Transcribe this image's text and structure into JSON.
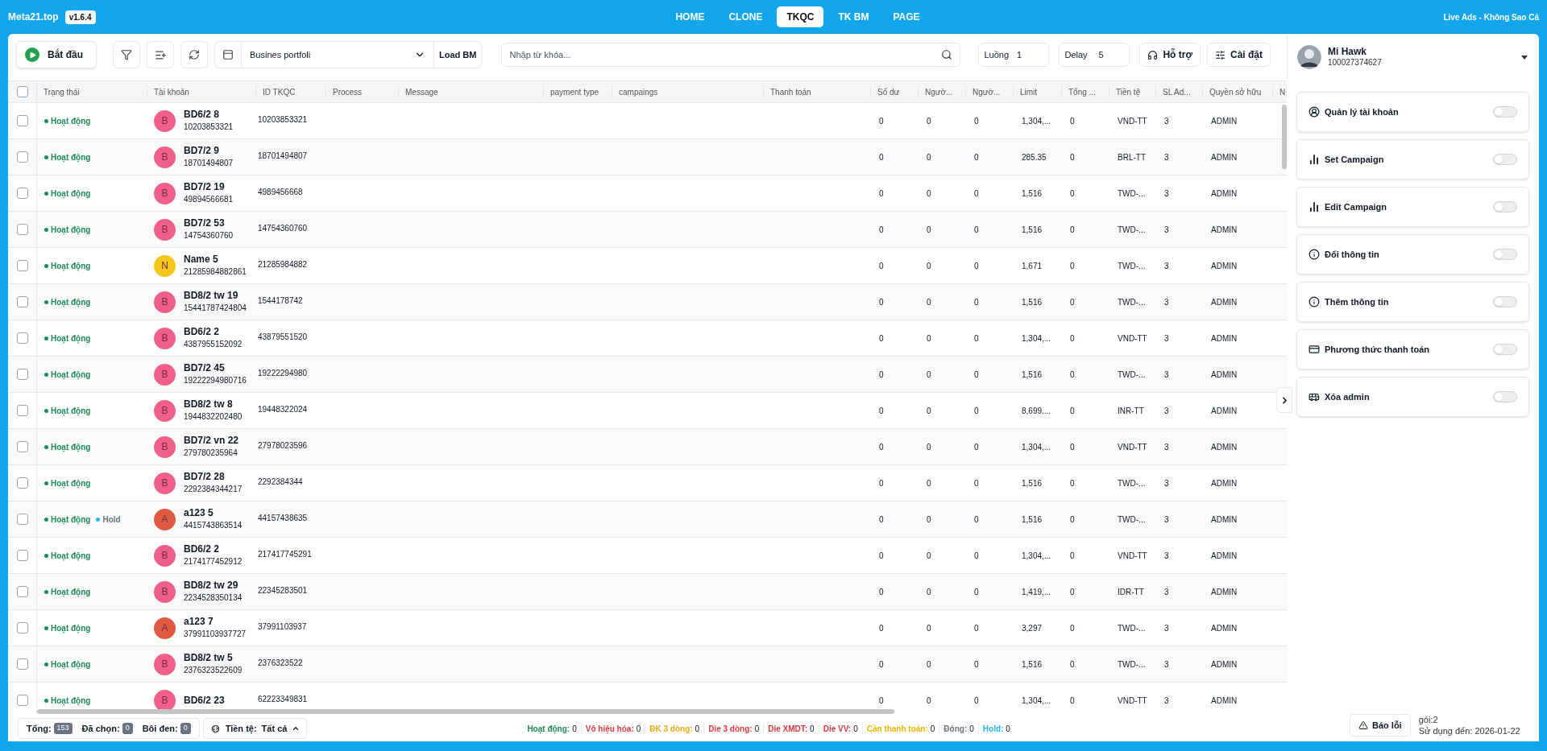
{
  "header": {
    "brand": "Meta21.top",
    "version": "v1.6.4",
    "tabs": [
      {
        "label": "HOME",
        "selected": false
      },
      {
        "label": "CLONE",
        "selected": false
      },
      {
        "label": "TKQC",
        "selected": true
      },
      {
        "label": "TK BM",
        "selected": false
      },
      {
        "label": "PAGE",
        "selected": false
      }
    ],
    "tagline": "Live Ads - Không Sao Cả"
  },
  "toolbar": {
    "start_label": "Bắt đầu",
    "portfolio_select": {
      "value": "Busines portfoli"
    },
    "load_bm_label": "Load BM",
    "search": {
      "placeholder": "Nhập từ khóa..."
    },
    "threads": {
      "label": "Luồng",
      "value": "1"
    },
    "delay": {
      "label": "Delay",
      "value": "5"
    },
    "support_label": "Hỗ trợ",
    "settings_label": "Cài đặt"
  },
  "user": {
    "name": "Mi Hawk",
    "id": "100027374627"
  },
  "table": {
    "select_all": {
      "checked": false
    },
    "columns": [
      "Trạng thái",
      "Tài khoản",
      "ID TKQC",
      "Process",
      "Message",
      "payment type",
      "campaings",
      "Thanh toán",
      "Số dư",
      "Ngườ...",
      "Ngườ...",
      "Limit",
      "Tổng ...",
      "Tiền tệ",
      "SL Ad...",
      "Quyền sở hữu",
      "N"
    ],
    "rows": [
      {
        "checked": false,
        "statuses": [
          {
            "text": "Hoạt động",
            "color": "#1e8a5a"
          }
        ],
        "avatar": {
          "letter": "B",
          "color": "#ee5f8a"
        },
        "name": "BD6/2 8",
        "sub_id": "10203853321",
        "ad_id": "10203853321",
        "values": [
          "0",
          "0",
          "0",
          "1,304,...",
          "0",
          "VND-TT",
          "3",
          "ADMIN"
        ]
      },
      {
        "checked": false,
        "statuses": [
          {
            "text": "Hoạt động",
            "color": "#1e8a5a"
          }
        ],
        "avatar": {
          "letter": "B",
          "color": "#ee5f8a"
        },
        "name": "BD7/2 9",
        "sub_id": "18701494807",
        "ad_id": "18701494807",
        "values": [
          "0",
          "0",
          "0",
          "285.35",
          "0",
          "BRL-TT",
          "3",
          "ADMIN"
        ]
      },
      {
        "checked": false,
        "statuses": [
          {
            "text": "Hoạt động",
            "color": "#1e8a5a"
          }
        ],
        "avatar": {
          "letter": "B",
          "color": "#ee5f8a"
        },
        "name": "BD7/2 19",
        "sub_id": "49894566681",
        "ad_id": "4989456668",
        "values": [
          "0",
          "0",
          "0",
          "1,516",
          "0",
          "TWD-...",
          "3",
          "ADMIN"
        ]
      },
      {
        "checked": false,
        "statuses": [
          {
            "text": "Hoạt động",
            "color": "#1e8a5a"
          }
        ],
        "avatar": {
          "letter": "B",
          "color": "#ee5f8a"
        },
        "name": "BD7/2 53",
        "sub_id": "14754360760",
        "ad_id": "14754360760",
        "values": [
          "0",
          "0",
          "0",
          "1,516",
          "0",
          "TWD-...",
          "3",
          "ADMIN"
        ]
      },
      {
        "checked": false,
        "statuses": [
          {
            "text": "Hoạt động",
            "color": "#1e8a5a"
          }
        ],
        "avatar": {
          "letter": "N",
          "color": "#f5c518"
        },
        "name": "Name 5",
        "sub_id": "21285984882861",
        "ad_id": "21285984882",
        "values": [
          "0",
          "0",
          "0",
          "1,671",
          "0",
          "TWD-...",
          "3",
          "ADMIN"
        ]
      },
      {
        "checked": false,
        "statuses": [
          {
            "text": "Hoạt động",
            "color": "#1e8a5a"
          }
        ],
        "avatar": {
          "letter": "B",
          "color": "#ee5f8a"
        },
        "name": "BD8/2 tw 19",
        "sub_id": "15441787424804",
        "ad_id": "1544178742",
        "values": [
          "0",
          "0",
          "0",
          "1,516",
          "0",
          "TWD-...",
          "3",
          "ADMIN"
        ]
      },
      {
        "checked": false,
        "statuses": [
          {
            "text": "Hoạt động",
            "color": "#1e8a5a"
          }
        ],
        "avatar": {
          "letter": "B",
          "color": "#ee5f8a"
        },
        "name": "BD6/2 2",
        "sub_id": "4387955152092",
        "ad_id": "43879551520",
        "values": [
          "0",
          "0",
          "0",
          "1,304,...",
          "0",
          "VND-TT",
          "3",
          "ADMIN"
        ]
      },
      {
        "checked": false,
        "statuses": [
          {
            "text": "Hoạt động",
            "color": "#1e8a5a"
          }
        ],
        "avatar": {
          "letter": "B",
          "color": "#ee5f8a"
        },
        "name": "BD7/2 45",
        "sub_id": "19222294980716",
        "ad_id": "19222294980",
        "values": [
          "0",
          "0",
          "0",
          "1,516",
          "0",
          "TWD-...",
          "3",
          "ADMIN"
        ]
      },
      {
        "checked": false,
        "statuses": [
          {
            "text": "Hoạt động",
            "color": "#1e8a5a"
          }
        ],
        "avatar": {
          "letter": "B",
          "color": "#ee5f8a"
        },
        "name": "BD8/2 tw 8",
        "sub_id": "1944832202480",
        "ad_id": "19448322024",
        "values": [
          "0",
          "0",
          "0",
          "8,699....",
          "0",
          "INR-TT",
          "3",
          "ADMIN"
        ]
      },
      {
        "checked": false,
        "statuses": [
          {
            "text": "Hoạt động",
            "color": "#1e8a5a"
          }
        ],
        "avatar": {
          "letter": "B",
          "color": "#ee5f8a"
        },
        "name": "BD7/2 vn 22",
        "sub_id": "279780235964",
        "ad_id": "27978023596",
        "values": [
          "0",
          "0",
          "0",
          "1,304,...",
          "0",
          "VND-TT",
          "3",
          "ADMIN"
        ]
      },
      {
        "checked": false,
        "statuses": [
          {
            "text": "Hoạt động",
            "color": "#1e8a5a"
          }
        ],
        "avatar": {
          "letter": "B",
          "color": "#ee5f8a"
        },
        "name": "BD7/2 28",
        "sub_id": "2292384344217",
        "ad_id": "2292384344",
        "values": [
          "0",
          "0",
          "0",
          "1,516",
          "0",
          "TWD-...",
          "3",
          "ADMIN"
        ]
      },
      {
        "checked": false,
        "statuses": [
          {
            "text": "Hoạt động",
            "color": "#1e8a5a"
          },
          {
            "text": "Hold",
            "color": "#22b8e6"
          }
        ],
        "avatar": {
          "letter": "A",
          "color": "#e05a42"
        },
        "name": "a123 5",
        "sub_id": "4415743863514",
        "ad_id": "44157438635",
        "values": [
          "0",
          "0",
          "0",
          "1,516",
          "0",
          "TWD-...",
          "3",
          "ADMIN"
        ]
      },
      {
        "checked": false,
        "statuses": [
          {
            "text": "Hoạt động",
            "color": "#1e8a5a"
          }
        ],
        "avatar": {
          "letter": "B",
          "color": "#ee5f8a"
        },
        "name": "BD6/2 2",
        "sub_id": "2174177452912",
        "ad_id": "217417745291",
        "values": [
          "0",
          "0",
          "0",
          "1,304,...",
          "0",
          "VND-TT",
          "3",
          "ADMIN"
        ]
      },
      {
        "checked": false,
        "statuses": [
          {
            "text": "Hoạt động",
            "color": "#1e8a5a"
          }
        ],
        "avatar": {
          "letter": "B",
          "color": "#ee5f8a"
        },
        "name": "BD8/2 tw 29",
        "sub_id": "2234528350134",
        "ad_id": "22345283501",
        "values": [
          "0",
          "0",
          "0",
          "1,419,...",
          "0",
          "IDR-TT",
          "3",
          "ADMIN"
        ]
      },
      {
        "checked": false,
        "statuses": [
          {
            "text": "Hoạt động",
            "color": "#1e8a5a"
          }
        ],
        "avatar": {
          "letter": "A",
          "color": "#e05a42"
        },
        "name": "a123 7",
        "sub_id": "37991103937727",
        "ad_id": "37991103937",
        "values": [
          "0",
          "0",
          "0",
          "3,297",
          "0",
          "TWD-...",
          "3",
          "ADMIN"
        ]
      },
      {
        "checked": false,
        "statuses": [
          {
            "text": "Hoạt động",
            "color": "#1e8a5a"
          }
        ],
        "avatar": {
          "letter": "B",
          "color": "#ee5f8a"
        },
        "name": "BD8/2 tw 5",
        "sub_id": "2376323522609",
        "ad_id": "2376323522",
        "values": [
          "0",
          "0",
          "0",
          "1,516",
          "0",
          "TWD-...",
          "3",
          "ADMIN"
        ]
      },
      {
        "checked": false,
        "statuses": [
          {
            "text": "Hoạt động",
            "color": "#1e8a5a"
          }
        ],
        "avatar": {
          "letter": "B",
          "color": "#ee5f8a"
        },
        "name": "BD6/2 23",
        "ad_id": "62223349831",
        "values": [
          "0",
          "0",
          "0",
          "1,304,...",
          "0",
          "VND-TT",
          "3",
          "ADMIN"
        ]
      }
    ]
  },
  "tools": [
    {
      "kind": "user",
      "label": "Quản lý tài khoản",
      "on": false
    },
    {
      "kind": "chart",
      "label": "Set Campaign",
      "on": false
    },
    {
      "kind": "chart",
      "label": "Edit Campaign",
      "on": false
    },
    {
      "kind": "info",
      "label": "Đổi thông tin",
      "on": false
    },
    {
      "kind": "info",
      "label": "Thêm thông tin",
      "on": false
    },
    {
      "kind": "card",
      "label": "Phương thức thanh toán",
      "on": false
    },
    {
      "kind": "bus",
      "label": "Xóa admin",
      "on": false
    }
  ],
  "footer": {
    "counts": [
      {
        "label": "Tổng:",
        "value": "153"
      },
      {
        "label": "Đã chọn:",
        "value": "0"
      },
      {
        "label": "Bôi đen:",
        "value": "0"
      }
    ],
    "currency": {
      "label": "Tiền tệ:",
      "value": "Tất cả"
    },
    "statuses": [
      {
        "label": "Hoạt động:",
        "value": "0",
        "color": "#1f8a55"
      },
      {
        "label": "Vô hiệu hóa:",
        "value": "0",
        "color": "#e0383e"
      },
      {
        "label": "ĐK 3 dòng:",
        "value": "0",
        "color": "#f0a814"
      },
      {
        "label": "Die 3 dòng:",
        "value": "0",
        "color": "#e0383e"
      },
      {
        "label": "Die XMDT:",
        "value": "0",
        "color": "#e0383e"
      },
      {
        "label": "Die VV:",
        "value": "0",
        "color": "#e0383e"
      },
      {
        "label": "Cần thanh toán:",
        "value": "0",
        "color": "#f0b400"
      },
      {
        "label": "Đóng:",
        "value": "0",
        "color": "#6b7280"
      },
      {
        "label": "Hold:",
        "value": "0",
        "color": "#22b8e6"
      }
    ],
    "report_label": "Báo lỗi",
    "plan": "gói:2",
    "expiry": "Sử dụng đến: 2026-01-22"
  }
}
